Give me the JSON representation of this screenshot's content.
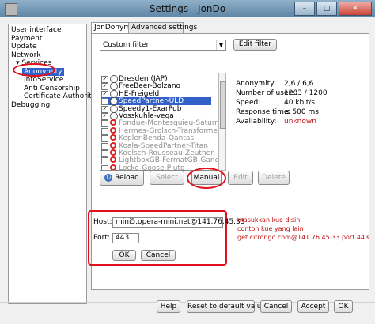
{
  "window": {
    "title": "Settings - JonDo",
    "min": "–",
    "max": "□",
    "close": "✕"
  },
  "tree": {
    "items": [
      "User interface",
      "Payment",
      "Update",
      "Network",
      "Services",
      "Anonymity",
      "InfoService",
      "Anti Censorship",
      "Certificate Authorities",
      "Debugging"
    ],
    "services_expander": "▾",
    "selected": "Anonymity"
  },
  "tabs": [
    "JonDonym",
    "Advanced settings"
  ],
  "filter": {
    "value": "Custom filter",
    "edit_label": "Edit filter"
  },
  "servers": [
    {
      "name": "Dresden (JAP)",
      "checked": true,
      "available": true
    },
    {
      "name": "FreeBeer-Bolzano",
      "checked": true,
      "available": true
    },
    {
      "name": "HE-Freigeld",
      "checked": true,
      "available": true
    },
    {
      "name": "SpeedPartner-ULD",
      "checked": true,
      "available": true,
      "selected": true
    },
    {
      "name": "Speedy1-ExarPub",
      "checked": true,
      "available": true
    },
    {
      "name": "Vosskuhle-vega",
      "checked": true,
      "available": true
    },
    {
      "name": "Fondue-Montesquieu-Saturn",
      "checked": false,
      "available": false
    },
    {
      "name": "Hermes-Grolsch-Transformer",
      "checked": false,
      "available": false
    },
    {
      "name": "Kepler-Benda-Qantas",
      "checked": false,
      "available": false
    },
    {
      "name": "Koala-SpeedPartner-Titan",
      "checked": false,
      "available": false
    },
    {
      "name": "Koelsch-Rousseau-Zeuthen",
      "checked": false,
      "available": false
    },
    {
      "name": "LightboxGB-FermatGB-GandalfGB",
      "checked": false,
      "available": false
    },
    {
      "name": "Locke-Goose-Pluto",
      "checked": false,
      "available": false
    }
  ],
  "info": {
    "anonymity_label": "Anonymity:",
    "anonymity_value": "2,6 / 6,6",
    "users_label": "Number of users:",
    "users_value": "1203 / 1200",
    "speed_label": "Speed:",
    "speed_value": "40 kbit/s",
    "response_label": "Response time:",
    "response_value": "≤ 500 ms",
    "availability_label": "Availability:",
    "availability_value": "unknown"
  },
  "actions": {
    "reload": "Reload",
    "select": "Select",
    "manual": "Manual",
    "edit": "Edit",
    "delete": "Delete"
  },
  "manual": {
    "host_label": "Host:",
    "host_value": "mini5.opera-mini.net@141.76.45.33",
    "port_label": "Port:",
    "port_value": "443",
    "ok": "OK",
    "cancel": "Cancel"
  },
  "annotation": [
    "masukkan kue disini",
    "contoh kue yang lain",
    "get.citrongo.com@141.76.45.33 port 443"
  ],
  "footer": {
    "help": "Help",
    "reset": "Reset to default values",
    "cancel": "Cancel",
    "accept": "Accept",
    "ok": "OK"
  },
  "colors": {
    "highlight": "#e0101c",
    "selection": "#3060c8"
  }
}
